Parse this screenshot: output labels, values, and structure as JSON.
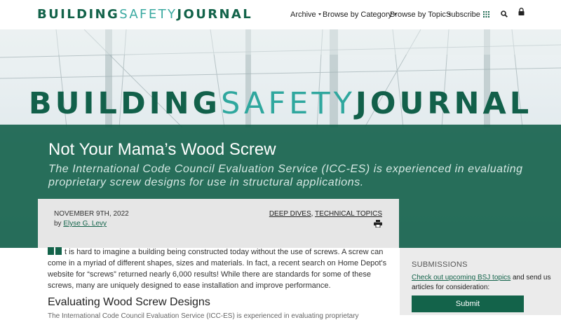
{
  "site": {
    "logo": {
      "part1": "BUILDING",
      "part2": "SAFETY",
      "part3": "JOURNAL"
    },
    "nav": {
      "archive": "Archive",
      "browse_category": "Browse by Category",
      "browse_topic": "Browse by Topic",
      "subscribe": "Subscribe"
    },
    "icons": [
      "grid-icon",
      "search-icon",
      "lock-icon"
    ],
    "colors": {
      "brand_green": "#13634a",
      "brand_teal": "#2fa79e",
      "meta_gray": "#e6e6e6"
    }
  },
  "hero": {
    "masthead": {
      "part1": "BUILDING",
      "part2": "SAFETY",
      "part3": "JOURNAL"
    }
  },
  "article": {
    "title": "Not Your Mama’s Wood Screw",
    "subtitle": "The International Code Council Evaluation Service (ICC-ES) is experienced in evaluating proprietary screw designs for use in structural applications.",
    "date": "NOVEMBER 9TH, 2022",
    "by": "by",
    "author": "Elyse G. Levy",
    "categories": [
      "DEEP DIVES",
      "TECHNICAL TOPICS"
    ],
    "category_sep": ",",
    "intro": "t is hard to imagine a building being constructed today without the use of screws. A screw can come in a myriad of different shapes, sizes and materials. In fact, a recent search on Home Depot's website for “screws” returned nearly 6,000 results! While there are standards for some of these screws, many are uniquely designed to ease installation and improve performance.",
    "section_heading": "Evaluating Wood Screw Designs",
    "next_line": "The International Code Council Evaluation Service (ICC-ES) is experienced in evaluating proprietary"
  },
  "sidebar": {
    "heading": "SUBMISSIONS",
    "link": "Check out upcoming BSJ topics",
    "text": " and send us articles for consideration:",
    "button": "Submit"
  }
}
